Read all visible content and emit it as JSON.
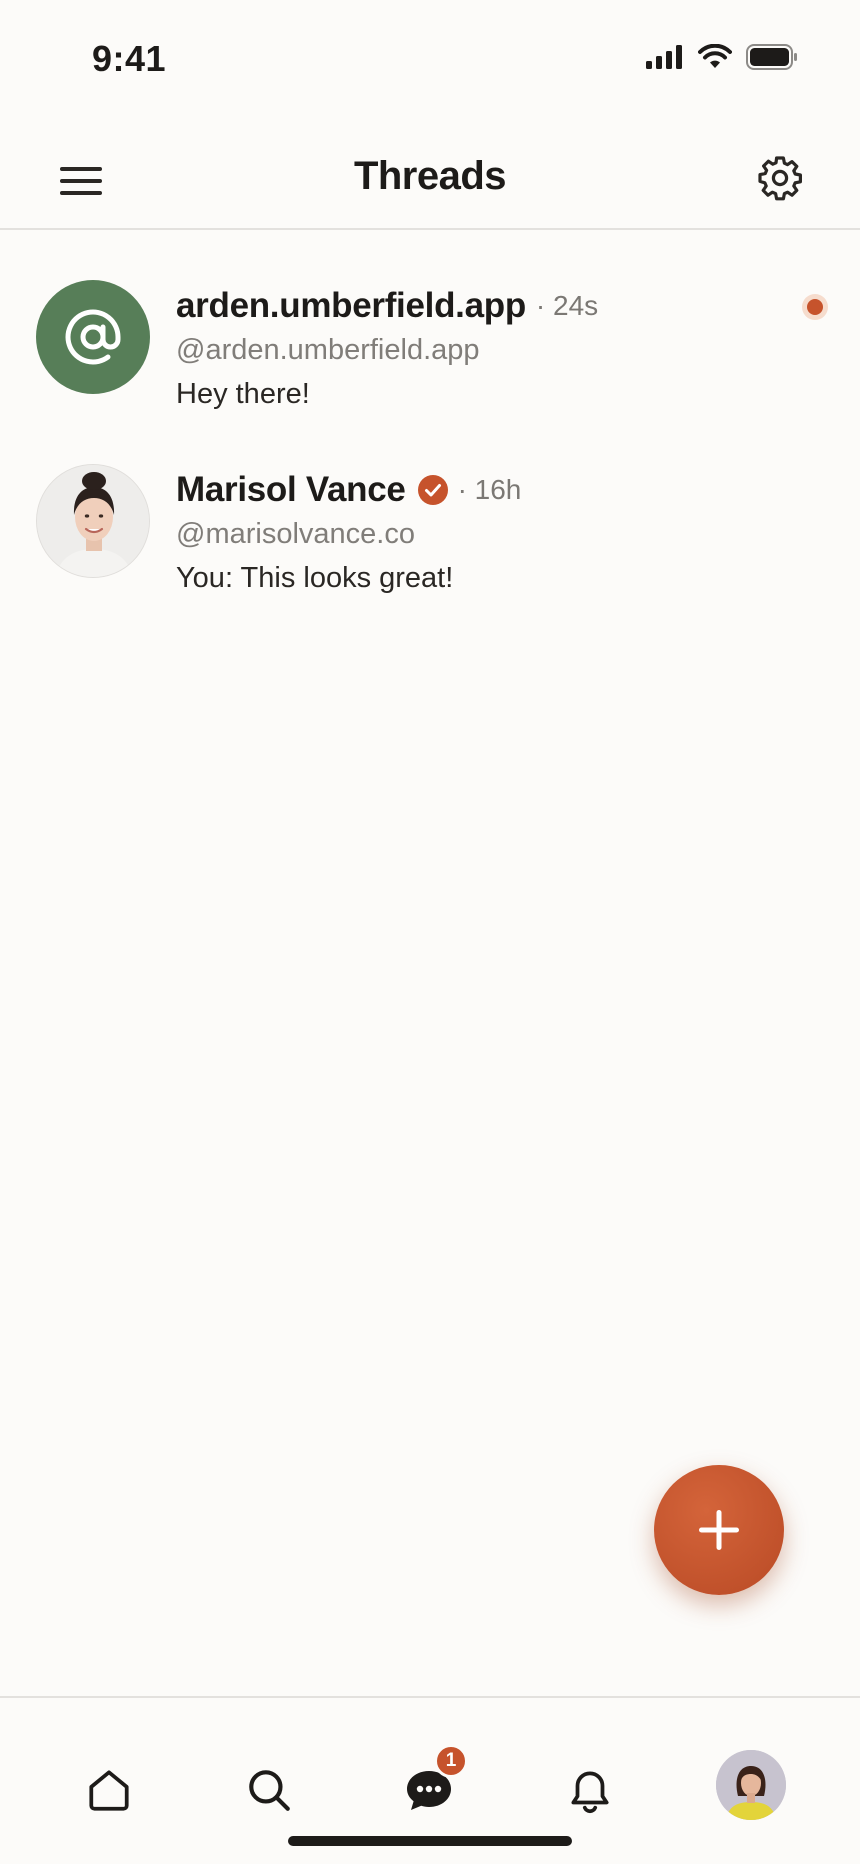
{
  "status_bar": {
    "time": "9:41"
  },
  "header": {
    "title": "Threads"
  },
  "threads": [
    {
      "name": "arden.umberfield.app",
      "time": "· 24s",
      "handle": "@arden.umberfield.app",
      "preview": "Hey there!",
      "avatar": "at-sign-icon",
      "unread": true,
      "verified": false
    },
    {
      "name": "Marisol Vance",
      "time": "· 16h",
      "handle": "@marisolvance.co",
      "preview": "You: This looks great!",
      "avatar": "photo",
      "unread": false,
      "verified": true
    }
  ],
  "tabbar": {
    "items": [
      "home-icon",
      "search-icon",
      "messages-icon",
      "bell-icon",
      "profile-avatar"
    ],
    "messages_badge": "1"
  },
  "colors": {
    "accent": "#c6532c",
    "avatar_green": "#577e58",
    "background": "#fcfbf9"
  }
}
